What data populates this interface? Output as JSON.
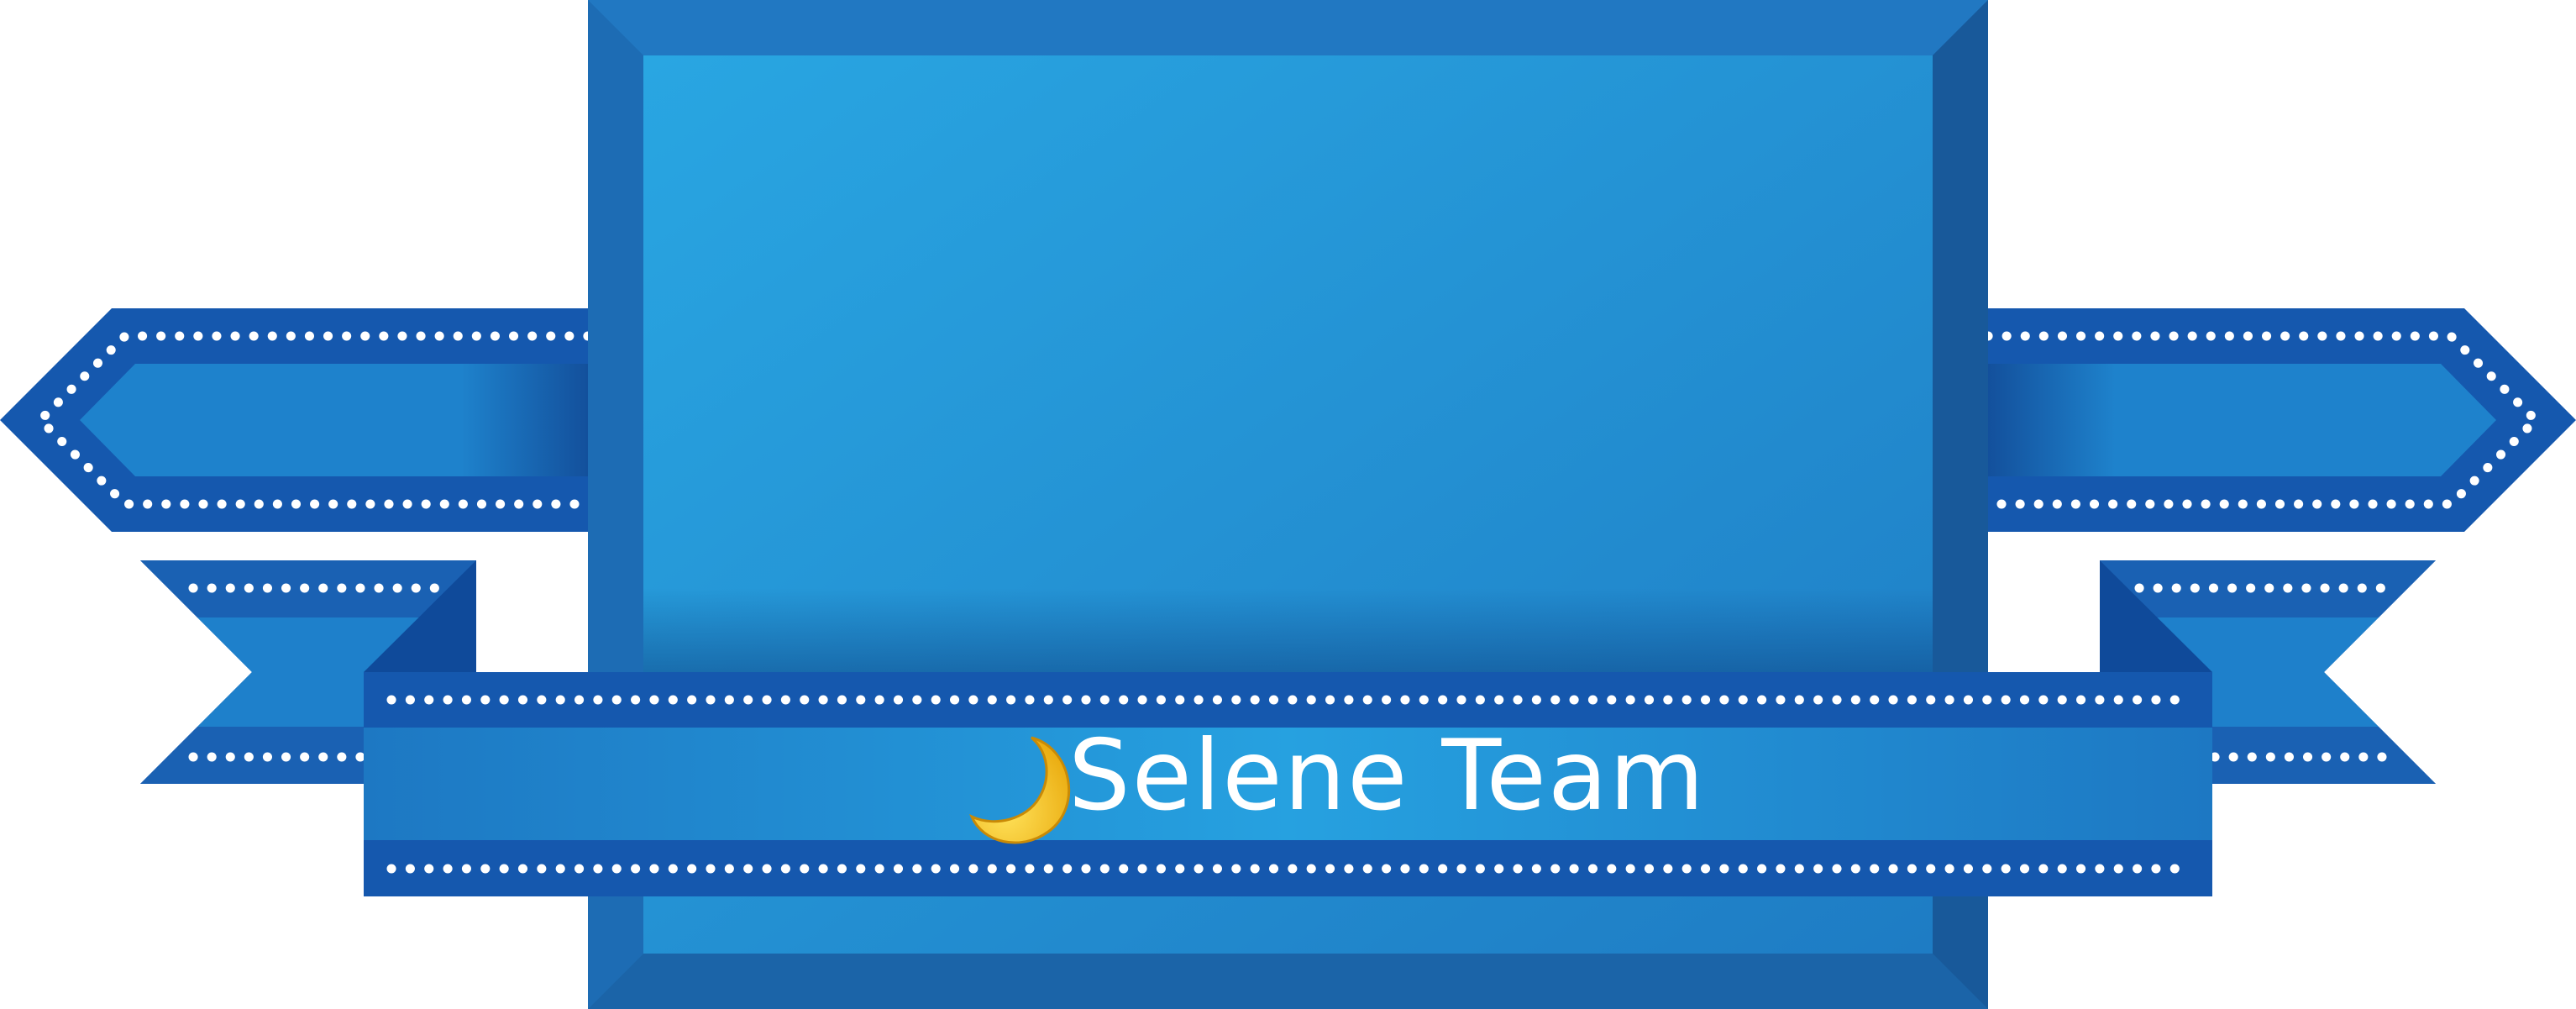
{
  "banner": {
    "team_name": "Selene Team",
    "logo_icon": "crescent-moon-icon"
  },
  "colors": {
    "panel_outer": "#1F72B9",
    "panel_inner_light": "#29A6E2",
    "panel_inner_dark": "#1E7CC4",
    "ribbon_edge": "#1558AE",
    "ribbon_mid": "#2292D6",
    "ribbon_fold": "#0F4A9A",
    "stitch": "#FFFFFF",
    "moon": "#F7C51B"
  }
}
